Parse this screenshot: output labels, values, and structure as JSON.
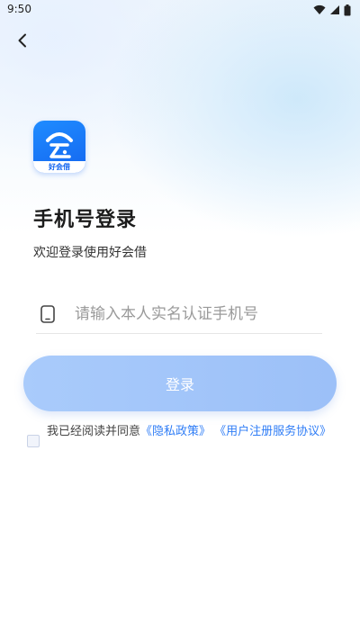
{
  "status_bar": {
    "time": "9:50"
  },
  "header": {
    "back_icon": "chevron-left-icon"
  },
  "app": {
    "logo_label": "好会借"
  },
  "login": {
    "title": "手机号登录",
    "subtitle": "欢迎登录使用好会借",
    "phone_placeholder": "请输入本人实名认证手机号",
    "phone_value": "",
    "button_label": "登录"
  },
  "agreement": {
    "checked": false,
    "prefix": "我已经阅读并同意",
    "privacy_link": "《隐私政策》",
    "separator": " ",
    "terms_link": "《用户注册服务协议》"
  },
  "colors": {
    "brand": "#1466f0",
    "link": "#2f7df6",
    "button_disabled": "#a9cbfb"
  }
}
